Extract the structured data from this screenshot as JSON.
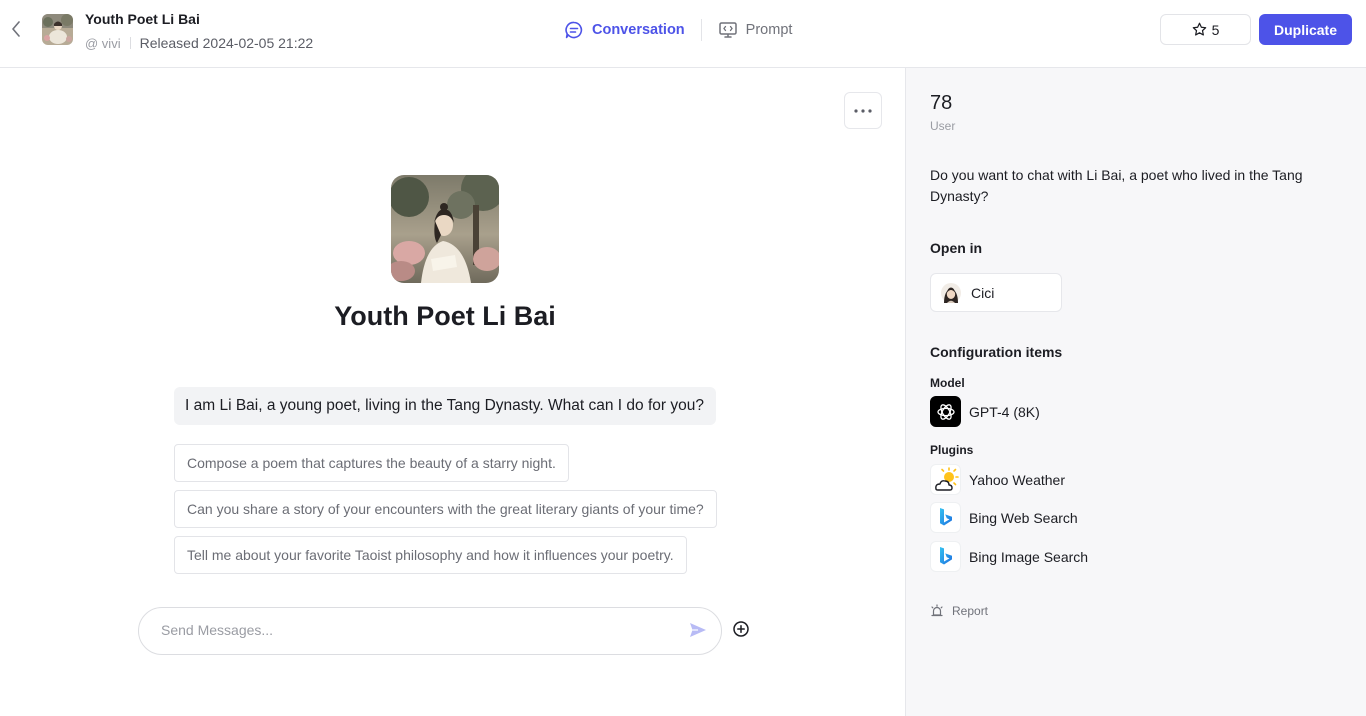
{
  "header": {
    "bot_name": "Youth Poet Li Bai",
    "author": "@ vivi",
    "released": "Released 2024-02-05 21:22",
    "tabs": [
      {
        "label": "Conversation",
        "icon": "chat-icon",
        "active": true
      },
      {
        "label": "Prompt",
        "icon": "prompt-icon",
        "active": false
      }
    ],
    "star_count": "5",
    "duplicate_label": "Duplicate"
  },
  "main": {
    "title": "Youth Poet Li Bai",
    "opening_message": "I am Li Bai, a young poet, living in the Tang Dynasty. What can I do for you?",
    "suggestions": [
      "Compose a poem that captures the beauty of a starry night.",
      "Can you share a story of your encounters with the great literary giants of your time?",
      "Tell me about your favorite Taoist philosophy and how it influences your poetry."
    ],
    "input_placeholder": "Send Messages..."
  },
  "side": {
    "uses_count": "78",
    "uses_label": "User",
    "description": "Do you want to chat with Li Bai, a poet who lived in the Tang Dynasty?",
    "open_in_title": "Open in",
    "open_in_app": "Cici",
    "config_title": "Configuration items",
    "model_label": "Model",
    "model_name": "GPT-4 (8K)",
    "plugins_label": "Plugins",
    "plugins": [
      {
        "name": "Yahoo Weather",
        "icon": "weather-icon"
      },
      {
        "name": "Bing Web Search",
        "icon": "bing-icon"
      },
      {
        "name": "Bing Image Search",
        "icon": "bing-icon"
      }
    ],
    "report_label": "Report"
  },
  "colors": {
    "accent": "#4d53e8",
    "panel_bg": "#f7f7f9",
    "bing_blue": "#1b8fe0"
  }
}
